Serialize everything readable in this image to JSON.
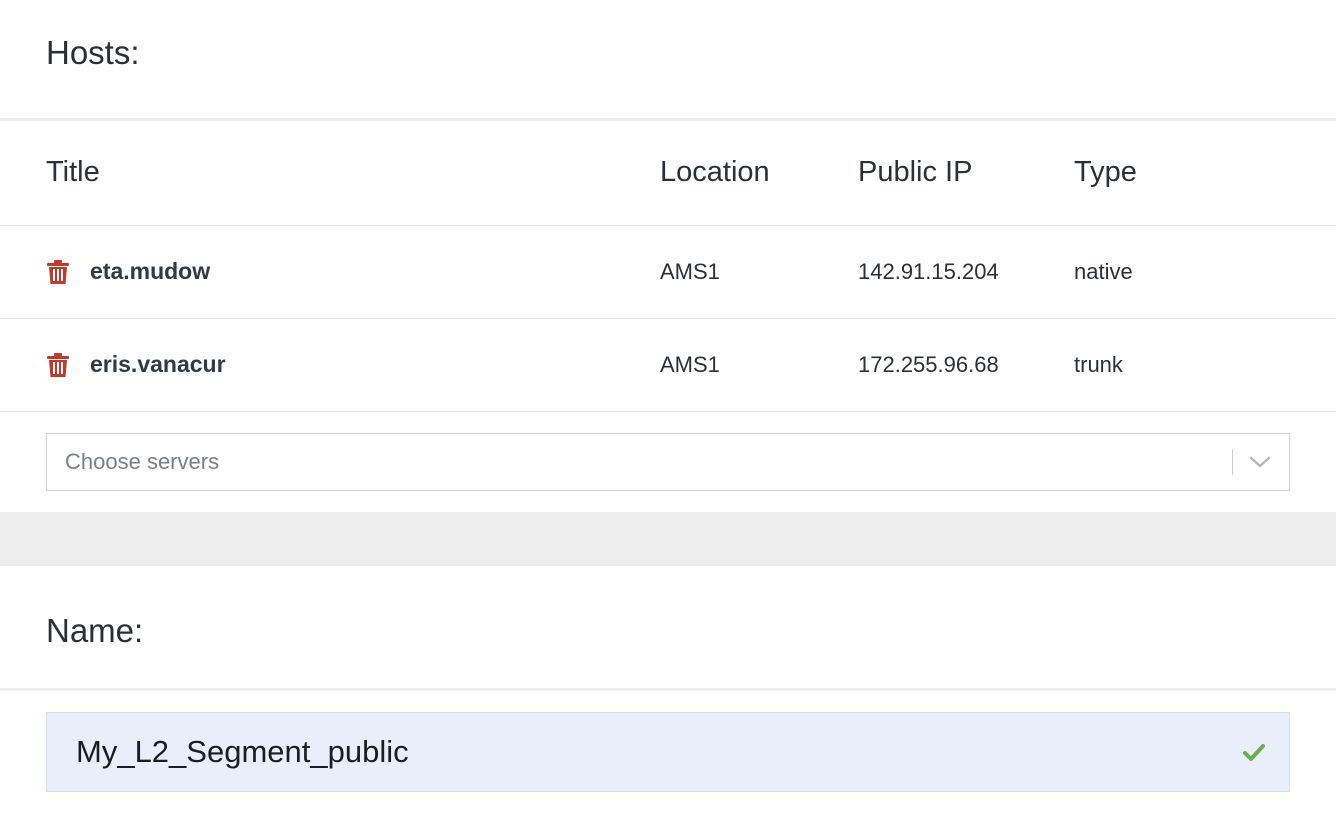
{
  "hosts_section": {
    "heading": "Hosts:"
  },
  "table": {
    "columns": [
      "Title",
      "Location",
      "Public IP",
      "Type"
    ],
    "rows": [
      {
        "title": "eta.mudow",
        "location": "AMS1",
        "public_ip": "142.91.15.204",
        "type": "native",
        "action_icon": "trash-icon"
      },
      {
        "title": "eris.vanacur",
        "location": "AMS1",
        "public_ip": "172.255.96.68",
        "type": "trunk",
        "action_icon": "trash-icon"
      }
    ]
  },
  "server_select": {
    "placeholder": "Choose servers",
    "icon": "chevron-down-icon"
  },
  "name_section": {
    "heading": "Name:",
    "value": "My_L2_Segment_public",
    "valid_icon": "check-icon"
  },
  "colors": {
    "trash": "#c0392b",
    "check": "#6ab04c",
    "input_bg": "#e8effb",
    "band": "#ededed"
  }
}
